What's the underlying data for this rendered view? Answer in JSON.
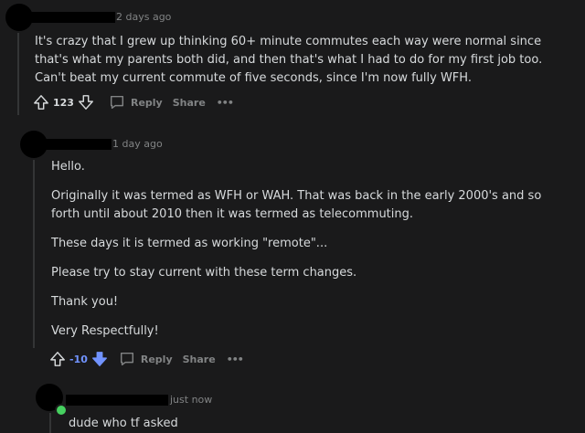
{
  "comment1": {
    "age": "2 days ago",
    "text": "It's crazy that I grew up thinking 60+ minute commutes each way were normal since that's what my parents both did, and then that's what I had to do for my first job too. Can't beat my current commute of five seconds, since I'm now fully WFH.",
    "votes": "123",
    "reply_label": "Reply",
    "share_label": "Share",
    "more_label": "•••"
  },
  "comment2": {
    "age": "1 day ago",
    "paragraphs": [
      "Hello.",
      "Originally it was termed as WFH or WAH. That was back in the early 2000's and so forth until about 2010 then it was termed as telecommuting.",
      "These days it is termed as working \"remote\"...",
      "Please try to stay current with these term changes.",
      "Thank you!",
      "Very Respectfully!"
    ],
    "votes": "-10",
    "reply_label": "Reply",
    "share_label": "Share",
    "more_label": "•••"
  },
  "comment3": {
    "age": "just now",
    "text": "dude who tf asked"
  },
  "colors": {
    "background": "#1a1a1b",
    "text": "#d7dadc",
    "meta": "#818384",
    "downvote": "#7193ff",
    "online": "#46d160"
  }
}
